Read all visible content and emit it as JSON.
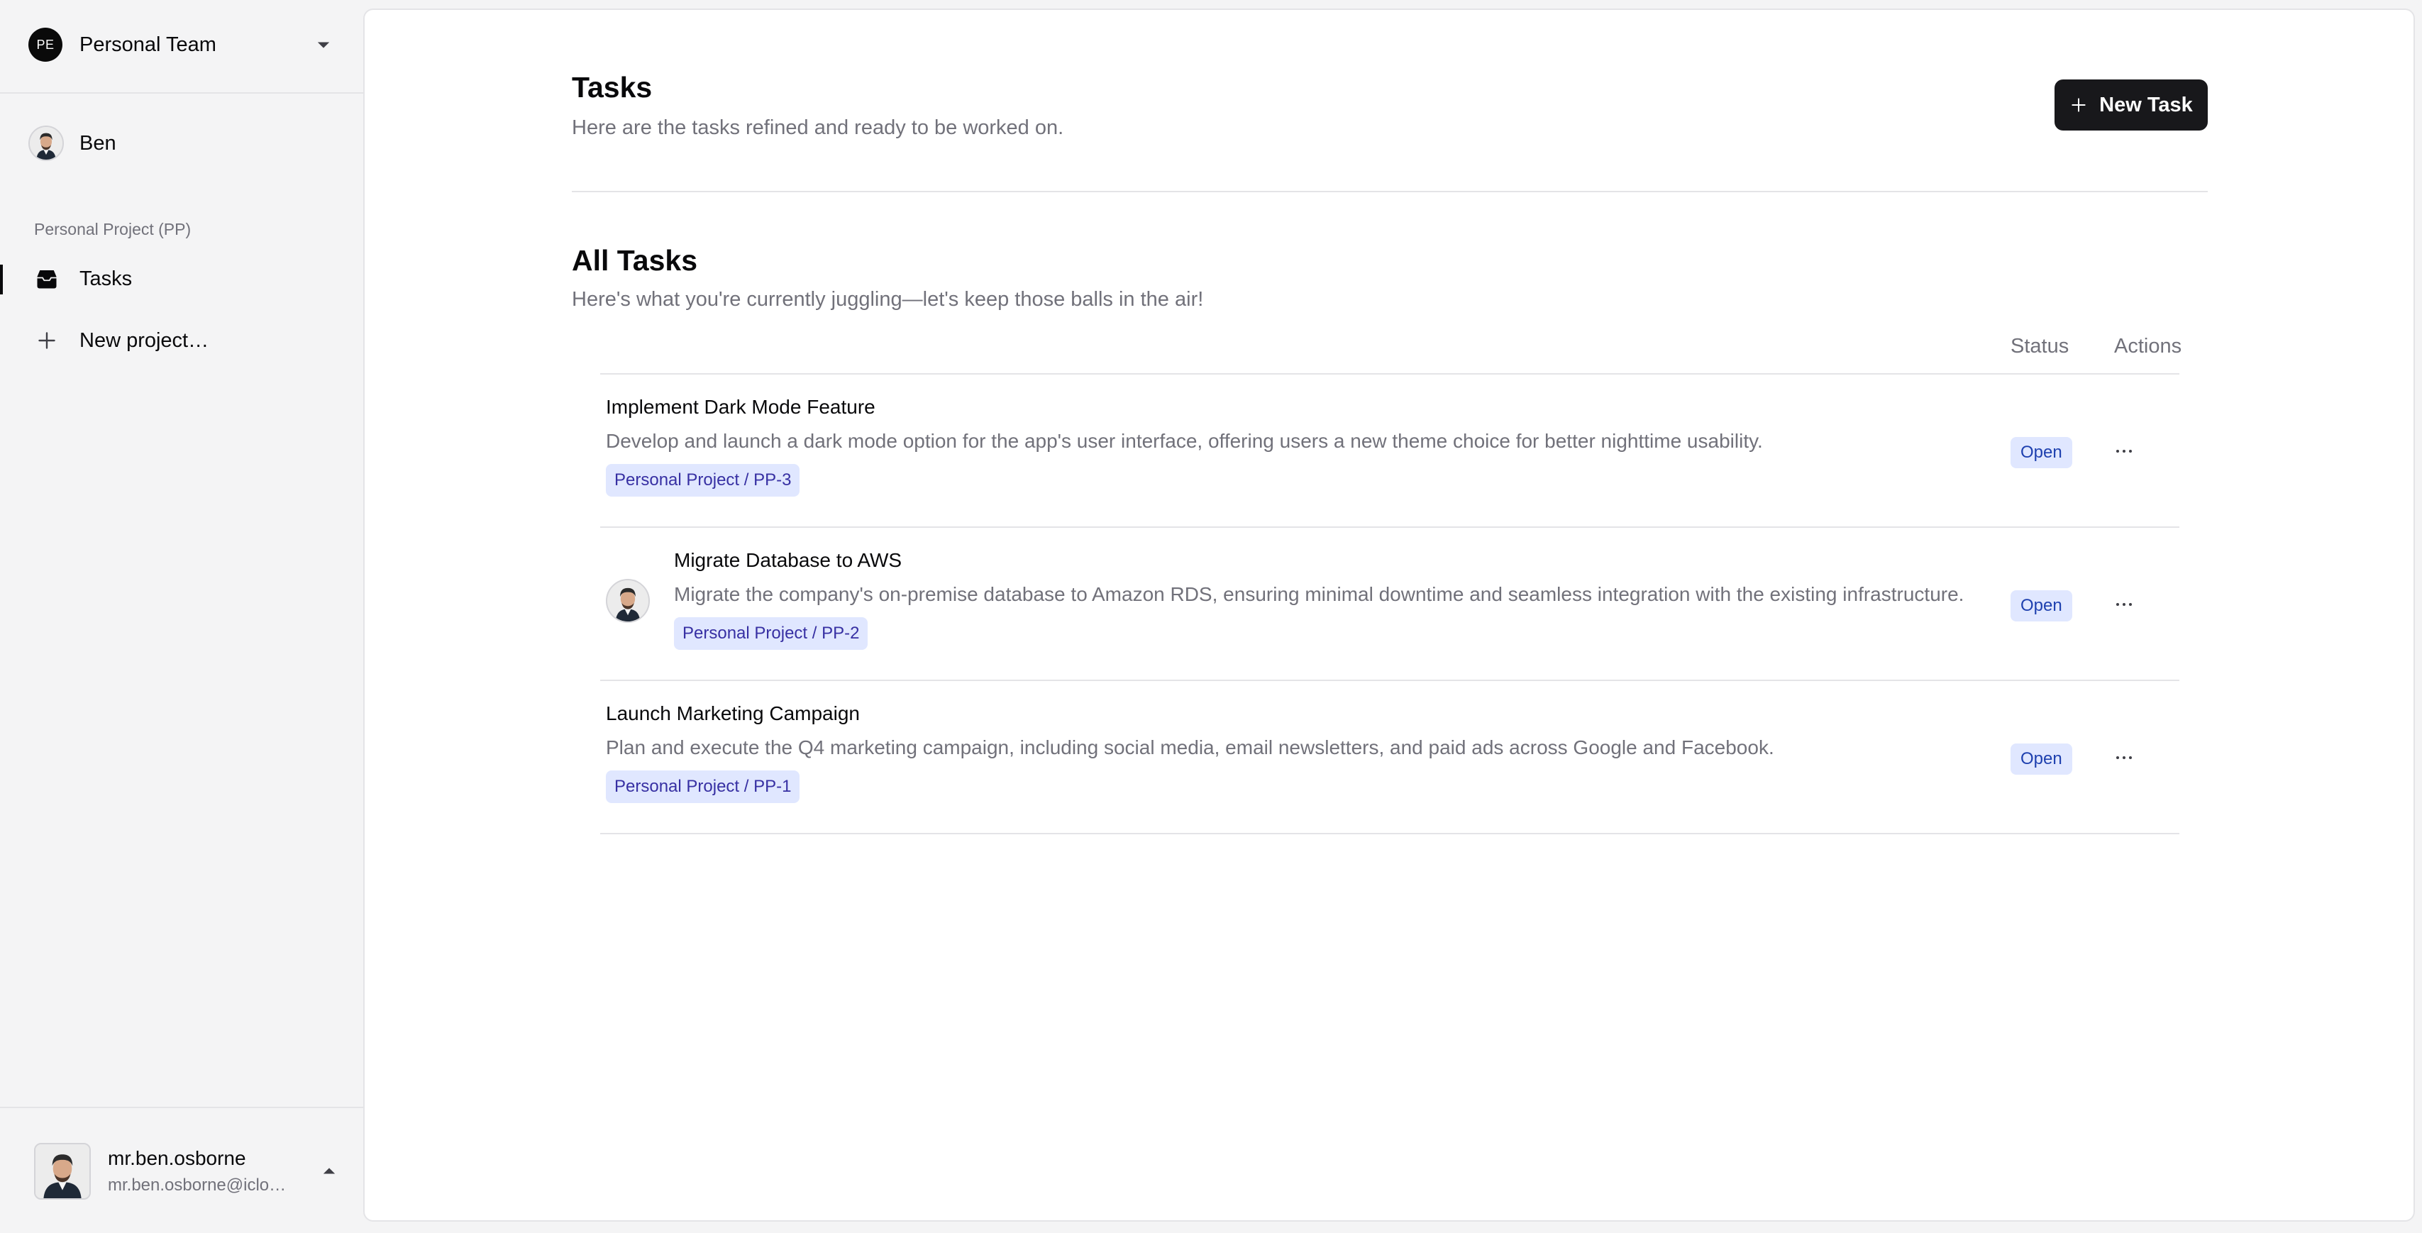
{
  "sidebar": {
    "team": {
      "badge": "PE",
      "name": "Personal Team"
    },
    "user": {
      "name": "Ben"
    },
    "project_label": "Personal Project (PP)",
    "nav": [
      {
        "label": "Tasks",
        "icon": "inbox-icon",
        "active": true
      },
      {
        "label": "New project…",
        "icon": "plus-icon",
        "active": false
      }
    ],
    "account": {
      "name": "mr.ben.osborne",
      "email": "mr.ben.osborne@iclo…"
    }
  },
  "header": {
    "title": "Tasks",
    "subtitle": "Here are the tasks refined and ready to be worked on.",
    "new_task_label": "New Task"
  },
  "tasks_section": {
    "title": "All Tasks",
    "subtitle": "Here's what you're currently juggling—let's keep those balls in the air!",
    "columns": {
      "status": "Status",
      "actions": "Actions"
    },
    "rows": [
      {
        "title": "Implement Dark Mode Feature",
        "description": "Develop and launch a dark mode option for the app's user interface, offering users a new theme choice for better nighttime usability.",
        "tag": "Personal Project / PP-3",
        "status": "Open",
        "has_assignee": false,
        "actions": "···"
      },
      {
        "title": "Migrate Database to AWS",
        "description": "Migrate the company's on-premise database to Amazon RDS, ensuring minimal downtime and seamless integration with the existing infrastructure.",
        "tag": "Personal Project / PP-2",
        "status": "Open",
        "has_assignee": true,
        "actions": "···"
      },
      {
        "title": "Launch Marketing Campaign",
        "description": "Plan and execute the Q4 marketing campaign, including social media, email newsletters, and paid ads across Google and Facebook.",
        "tag": "Personal Project / PP-1",
        "status": "Open",
        "has_assignee": false,
        "actions": "···"
      }
    ]
  },
  "colors": {
    "primary": "#18181b",
    "muted_text": "#71717a",
    "badge_bg": "#e0e7ff",
    "badge_text": "#3730a3",
    "border": "#e4e4e7"
  }
}
